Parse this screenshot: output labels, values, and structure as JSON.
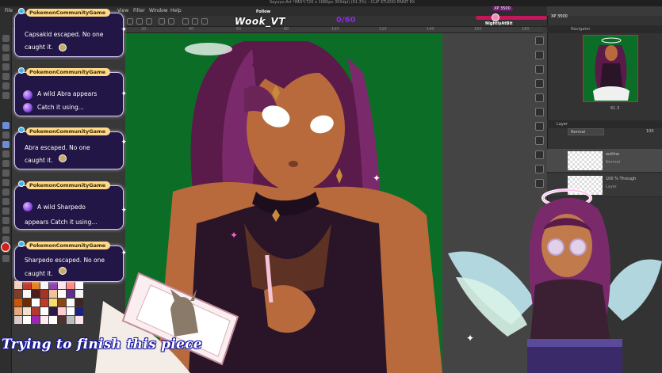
{
  "app": {
    "title": "Sayuyu-Art *IMG*(720 x 1080px 350dpi) (61.3%) - CLIP STUDIO PAINT EX",
    "menu": [
      "File",
      "View",
      "Filter",
      "Window",
      "Help"
    ],
    "ruler_labels": [
      "20",
      "40",
      "60",
      "80",
      "100",
      "120",
      "140",
      "160",
      "180",
      "200"
    ]
  },
  "stream": {
    "follow_label": "Follow",
    "channel": "Wook_VT",
    "counter": "0/60",
    "goal_label_1": "XP 3500",
    "goal_label_2": "XP 3500",
    "goal_user": "NightlyAtBit",
    "caption": "Trying to finish this piece"
  },
  "chat": [
    {
      "user": "PokemonCommunityGame",
      "lines": [
        "Capsakid escaped. No one",
        "caught it."
      ]
    },
    {
      "user": "PokemonCommunityGame",
      "lines": [
        "A wild Abra appears",
        "Catch it using..."
      ]
    },
    {
      "user": "PokemonCommunityGame",
      "lines": [
        "Abra escaped. No one",
        "caught it."
      ]
    },
    {
      "user": "PokemonCommunityGame",
      "lines": [
        "A wild Sharpedo",
        "appears   Catch it using..."
      ]
    },
    {
      "user": "PokemonCommunityGame",
      "lines": [
        "Sharpedo escaped. No one",
        "caught it."
      ]
    }
  ],
  "panels": {
    "navigator_tab": "Navigator",
    "zoom_value": "61.3",
    "layer_tab": "Layer",
    "blend_mode": "Normal",
    "opacity": "100",
    "layers": [
      {
        "name": "outline",
        "mode": "Normal"
      },
      {
        "name": "100 % Through",
        "mode": "Layer"
      }
    ]
  },
  "colors": {
    "canvas_green": "#0c6e26",
    "chat_bg": "#201446",
    "username_bg": "#ffd98a",
    "accent_pink": "#ff5fd2"
  }
}
